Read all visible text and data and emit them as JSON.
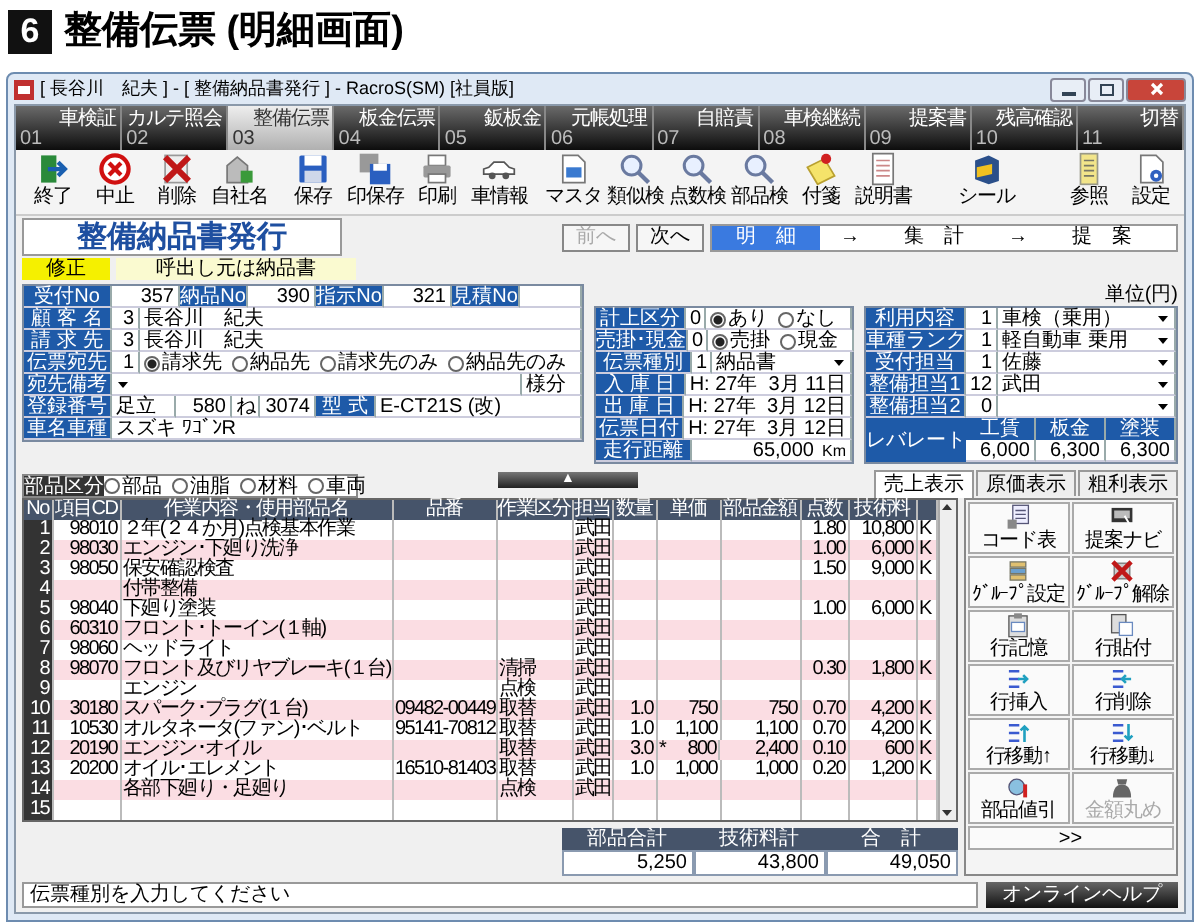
{
  "page_heading": {
    "number": "6",
    "title": "整備伝票 (明細画面)"
  },
  "window": {
    "title": "[ 長谷川　紀夫 ] - [ 整備納品書発行 ] - RacroS(SM) [社員版]"
  },
  "tabs": [
    {
      "number": "01",
      "label": "車検証",
      "selected": false
    },
    {
      "number": "02",
      "label": "カルテ照会",
      "selected": false
    },
    {
      "number": "03",
      "label": "整備伝票",
      "selected": true
    },
    {
      "number": "04",
      "label": "板金伝票",
      "selected": false
    },
    {
      "number": "05",
      "label": "鈑板金",
      "selected": false
    },
    {
      "number": "06",
      "label": "元帳処理",
      "selected": false
    },
    {
      "number": "07",
      "label": "自賠責",
      "selected": false
    },
    {
      "number": "08",
      "label": "車検継続",
      "selected": false
    },
    {
      "number": "09",
      "label": "提案書",
      "selected": false
    },
    {
      "number": "10",
      "label": "残高確認",
      "selected": false
    },
    {
      "number": "11",
      "label": "切替",
      "selected": false
    }
  ],
  "toolbar": [
    [
      {
        "label": "終了"
      },
      {
        "label": "中止"
      },
      {
        "label": "削除"
      },
      {
        "label": "自社名"
      }
    ],
    [
      {
        "label": "保存"
      },
      {
        "label": "印保存"
      },
      {
        "label": "印刷"
      },
      {
        "label": "車情報"
      }
    ],
    [
      {
        "label": "マスタ"
      },
      {
        "label": "類似検"
      },
      {
        "label": "点数検"
      },
      {
        "label": "部品検"
      },
      {
        "label": "付箋"
      },
      {
        "label": "説明書"
      }
    ],
    [
      {
        "label": "シール"
      }
    ],
    [
      {
        "label": "参照"
      },
      {
        "label": "設定"
      }
    ]
  ],
  "form_title": "整備納品書発行",
  "nav_buttons": [
    {
      "label": "前へ",
      "disabled": true
    },
    {
      "label": "次へ",
      "disabled": false
    }
  ],
  "steps": [
    {
      "label": "明　細",
      "selected": true
    },
    {
      "label": "集　計",
      "selected": false
    },
    {
      "label": "提　案",
      "selected": false
    }
  ],
  "step_arrows": [
    "→",
    "→"
  ],
  "mode_badge": "修正",
  "source_note": "呼出し元は納品書",
  "customer_form": {
    "numbers": [
      {
        "label": "受付No",
        "value": "357"
      },
      {
        "label": "納品No",
        "value": "390"
      },
      {
        "label": "指示No",
        "value": "321"
      },
      {
        "label": "見積No"
      }
    ],
    "customer": {
      "label": "顧 客 名",
      "code": "3",
      "name": "長谷川　紀夫"
    },
    "billing": {
      "label": "請 求 先",
      "code": "3",
      "name": "長谷川　紀夫"
    },
    "addressee": {
      "label": "伝票宛先",
      "code": "1",
      "options": [
        {
          "label": "請求先",
          "selected": true
        },
        {
          "label": "納品先",
          "selected": false
        },
        {
          "label": "請求先のみ",
          "selected": false
        },
        {
          "label": "納品先のみ",
          "selected": false
        }
      ]
    },
    "remarks": {
      "label": "宛先備考",
      "suffix": "様分"
    },
    "registration": {
      "label": "登録番号",
      "area": "足立",
      "class": "580",
      "kana": "ね",
      "number": "3074",
      "model_label": "型 式",
      "model": "E-CT21S (改)"
    },
    "vehicle": {
      "label": "車名車種",
      "value": "スズキ ﾜｺﾞﾝR"
    }
  },
  "slip_form": {
    "rows": [
      {
        "kind": "radio",
        "label": "計上区分",
        "code": "0",
        "options": [
          {
            "label": "あり",
            "selected": true
          },
          {
            "label": "なし",
            "selected": false
          }
        ]
      },
      {
        "kind": "radio",
        "label": "売掛･現金",
        "code": "0",
        "options": [
          {
            "label": "売掛",
            "selected": true
          },
          {
            "label": "現金",
            "selected": false
          }
        ]
      },
      {
        "kind": "select",
        "label": "伝票種別",
        "code": "1",
        "value": "納品書"
      },
      {
        "kind": "date",
        "label": "入 庫 日",
        "value": "H: 27年  3月 11日"
      },
      {
        "kind": "date",
        "label": "出 庫 日",
        "value": "H: 27年  3月 12日"
      },
      {
        "kind": "date",
        "label": "伝票日付",
        "value": "H: 27年  3月 12日"
      },
      {
        "kind": "distance",
        "label": "走行距離",
        "value": "65,000",
        "unit": "Km"
      }
    ]
  },
  "service_form": {
    "unit_note": "単位(円)",
    "rows": [
      {
        "label": "利用内容",
        "code": "1",
        "value": "車検（乗用）"
      },
      {
        "label": "車種ランク",
        "code": "1",
        "value": "軽自動車 乗用"
      },
      {
        "label": "受付担当",
        "code": "1",
        "value": "佐藤"
      },
      {
        "label": "整備担当1",
        "code": "12",
        "value": "武田"
      },
      {
        "label": "整備担当2",
        "code": "0"
      }
    ],
    "labor_rate": {
      "label": "レバレート",
      "columns": [
        {
          "label": "工賃",
          "value": "6,000"
        },
        {
          "label": "板金",
          "value": "6,300"
        },
        {
          "label": "塗装",
          "value": "6,300"
        }
      ]
    }
  },
  "parts_filter": {
    "label": "部品区分",
    "options": [
      {
        "label": "部品",
        "selected": false
      },
      {
        "label": "油脂",
        "selected": false
      },
      {
        "label": "材料",
        "selected": false
      },
      {
        "label": "車両",
        "selected": false
      }
    ]
  },
  "splitter_button": "▲",
  "view_tabs": [
    {
      "label": "売上表示",
      "selected": true
    },
    {
      "label": "原価表示",
      "selected": false
    },
    {
      "label": "粗利表示",
      "selected": false
    }
  ],
  "table": {
    "columns": [
      "No",
      "項目CD",
      "作業内容・使用部品名",
      "品番",
      "作業区分",
      "担当",
      "数量",
      "単価",
      "部品金額",
      "点数",
      "技術料"
    ],
    "rows": [
      {
        "no": "1",
        "code": "98010",
        "description": "２年(２４か月)点検基本作業",
        "staff": "武田",
        "points": "1.80",
        "technical_fee": "10,800",
        "column_12": "K"
      },
      {
        "no": "2",
        "code": "98030",
        "description": "エンジン･下廻り洗浄",
        "staff": "武田",
        "points": "1.00",
        "technical_fee": "6,000",
        "column_12": "K"
      },
      {
        "no": "3",
        "code": "98050",
        "description": "保安確認検査",
        "staff": "武田",
        "points": "1.50",
        "technical_fee": "9,000",
        "column_12": "K"
      },
      {
        "no": "4",
        "description": "付帯整備",
        "staff": "武田"
      },
      {
        "no": "5",
        "code": "98040",
        "description": "下廻り塗装",
        "staff": "武田",
        "points": "1.00",
        "technical_fee": "6,000",
        "column_12": "K"
      },
      {
        "no": "6",
        "code": "60310",
        "description": "フロント･トーイン(１軸)",
        "staff": "武田"
      },
      {
        "no": "7",
        "code": "98060",
        "description": "ヘッドライト",
        "staff": "武田"
      },
      {
        "no": "8",
        "code": "98070",
        "description": "フロント及びリヤブレーキ(１台)",
        "work_type": "清掃",
        "staff": "武田",
        "points": "0.30",
        "technical_fee": "1,800",
        "column_12": "K"
      },
      {
        "no": "9",
        "description": "エンジン",
        "work_type": "点検",
        "staff": "武田"
      },
      {
        "no": "10",
        "code": "30180",
        "description": "スパーク･プラグ(１台)",
        "part_number": "09482-00449",
        "work_type": "取替",
        "staff": "武田",
        "quantity": "1.0",
        "unit_price": "750",
        "parts_amount": "750",
        "points": "0.70",
        "technical_fee": "4,200",
        "column_12": "K"
      },
      {
        "no": "11",
        "code": "10530",
        "description": "オルタネータ(ファン)･ベルト",
        "part_number": "95141-70812",
        "work_type": "取替",
        "staff": "武田",
        "quantity": "1.0",
        "unit_price": "1,100",
        "parts_amount": "1,100",
        "points": "0.70",
        "technical_fee": "4,200",
        "column_12": "K"
      },
      {
        "no": "12",
        "code": "20190",
        "description": "エンジン･オイル",
        "work_type": "取替",
        "staff": "武田",
        "quantity": "3.0",
        "unit_price_flag": "*",
        "unit_price": "800",
        "parts_amount": "2,400",
        "points": "0.10",
        "technical_fee": "600",
        "column_12": "K"
      },
      {
        "no": "13",
        "code": "20200",
        "description": "オイル･エレメント",
        "part_number": "16510-81403",
        "work_type": "取替",
        "staff": "武田",
        "quantity": "1.0",
        "unit_price": "1,000",
        "parts_amount": "1,000",
        "points": "0.20",
        "technical_fee": "1,200",
        "column_12": "K"
      },
      {
        "no": "14",
        "description": "各部下廻り・足廻り",
        "work_type": "点検",
        "staff": "武田"
      },
      {
        "no": "15"
      }
    ]
  },
  "totals": [
    {
      "label": "部品合計",
      "value": "5,250"
    },
    {
      "label": "技術料計",
      "value": "43,800"
    },
    {
      "label": "合　計",
      "value": "49,050"
    }
  ],
  "side_buttons": [
    {
      "label": "コード表",
      "disabled": false
    },
    {
      "label": "提案ナビ",
      "disabled": false
    },
    {
      "label": "ｸﾞﾙｰﾌﾟ設定",
      "disabled": false
    },
    {
      "label": "ｸﾞﾙｰﾌﾟ解除",
      "disabled": false
    },
    {
      "label": "行記憶",
      "disabled": false
    },
    {
      "label": "行貼付",
      "disabled": false
    },
    {
      "label": "行挿入",
      "disabled": false
    },
    {
      "label": "行削除",
      "disabled": false
    },
    {
      "label": "行移動↑",
      "disabled": false
    },
    {
      "label": "行移動↓",
      "disabled": false
    },
    {
      "label": "部品値引",
      "disabled": false
    },
    {
      "label": "金額丸め",
      "disabled": true
    }
  ],
  "more_button": ">>",
  "status_bar": {
    "message": "伝票種別を入力してください"
  },
  "help_button": "オンラインヘルプ"
}
